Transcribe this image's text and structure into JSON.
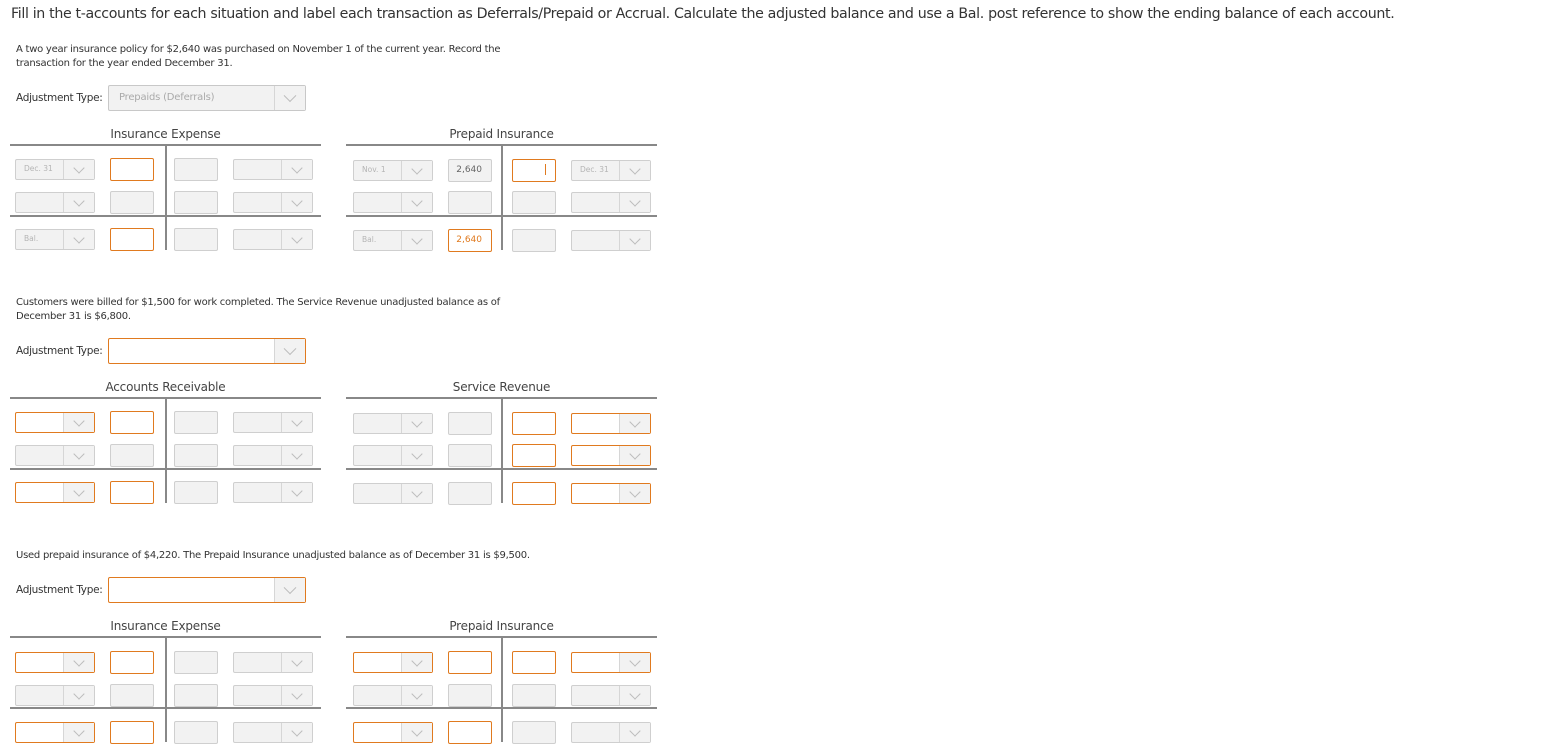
{
  "instructions": "Fill in the t-accounts for each situation and label each transaction as Deferrals/Prepaid or Accrual. Calculate the adjusted balance and use a Bal. post reference to show the ending balance of each account.",
  "adjustment_label": "Adjustment Type:",
  "problems": [
    {
      "description": "A two year insurance policy for $2,640 was purchased on November 1 of the current year. Record the transaction for the year ended December 31.",
      "adjustment_type": "Prepaids (Deferrals)",
      "accounts": [
        {
          "title": "Insurance Expense",
          "rows": [
            {
              "debit_ref": "Dec. 31",
              "debit_amount": "",
              "credit_amount": "",
              "credit_ref": ""
            },
            {
              "debit_ref": "",
              "debit_amount": "",
              "credit_amount": "",
              "credit_ref": ""
            },
            {
              "debit_ref": "Bal.",
              "debit_amount": "",
              "credit_amount": "",
              "credit_ref": ""
            }
          ]
        },
        {
          "title": "Prepaid Insurance",
          "rows": [
            {
              "debit_ref": "Nov. 1",
              "debit_amount": "2,640",
              "credit_amount": "",
              "credit_ref": "Dec. 31"
            },
            {
              "debit_ref": "",
              "debit_amount": "",
              "credit_amount": "",
              "credit_ref": ""
            },
            {
              "debit_ref": "Bal.",
              "debit_amount": "2,640",
              "credit_amount": "",
              "credit_ref": ""
            }
          ]
        }
      ]
    },
    {
      "description": "Customers were billed for $1,500 for work completed. The Service Revenue unadjusted balance as of December 31 is $6,800.",
      "adjustment_type": "",
      "accounts": [
        {
          "title": "Accounts Receivable",
          "rows": [
            {
              "debit_ref": "",
              "debit_amount": "",
              "credit_amount": "",
              "credit_ref": ""
            },
            {
              "debit_ref": "",
              "debit_amount": "",
              "credit_amount": "",
              "credit_ref": ""
            },
            {
              "debit_ref": "",
              "debit_amount": "",
              "credit_amount": "",
              "credit_ref": ""
            }
          ]
        },
        {
          "title": "Service Revenue",
          "rows": [
            {
              "debit_ref": "",
              "debit_amount": "",
              "credit_amount": "",
              "credit_ref": ""
            },
            {
              "debit_ref": "",
              "debit_amount": "",
              "credit_amount": "",
              "credit_ref": ""
            },
            {
              "debit_ref": "",
              "debit_amount": "",
              "credit_amount": "",
              "credit_ref": ""
            }
          ]
        }
      ]
    },
    {
      "description": "Used prepaid insurance of $4,220. The Prepaid Insurance unadjusted balance as of December 31 is $9,500.",
      "adjustment_type": "",
      "accounts": [
        {
          "title": "Insurance Expense",
          "rows": [
            {
              "debit_ref": "",
              "debit_amount": "",
              "credit_amount": "",
              "credit_ref": ""
            },
            {
              "debit_ref": "",
              "debit_amount": "",
              "credit_amount": "",
              "credit_ref": ""
            },
            {
              "debit_ref": "",
              "debit_amount": "",
              "credit_amount": "",
              "credit_ref": ""
            }
          ]
        },
        {
          "title": "Prepaid Insurance",
          "rows": [
            {
              "debit_ref": "",
              "debit_amount": "",
              "credit_amount": "",
              "credit_ref": ""
            },
            {
              "debit_ref": "",
              "debit_amount": "",
              "credit_amount": "",
              "credit_ref": ""
            },
            {
              "debit_ref": "",
              "debit_amount": "",
              "credit_amount": "",
              "credit_ref": ""
            }
          ]
        }
      ]
    }
  ]
}
